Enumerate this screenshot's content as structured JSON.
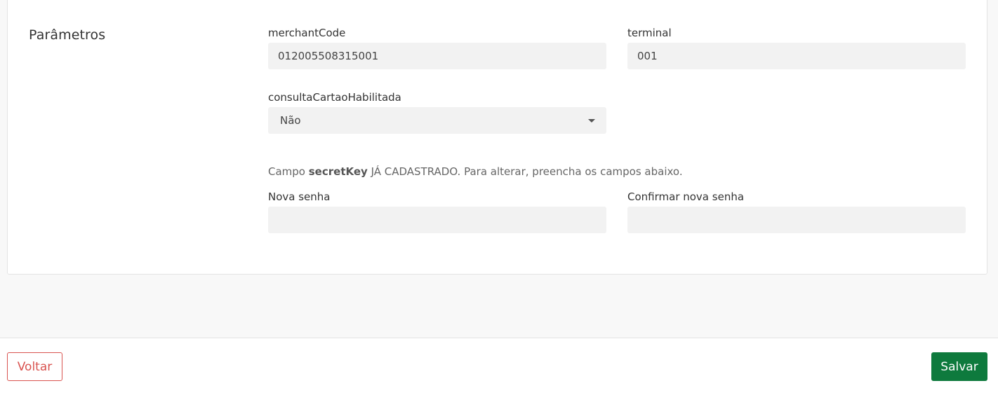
{
  "section": {
    "title": "Parâmetros"
  },
  "fields": {
    "merchant_code": {
      "label": "merchantCode",
      "value": "012005508315001"
    },
    "terminal": {
      "label": "terminal",
      "value": "001"
    },
    "consulta_cartao": {
      "label": "consultaCartaoHabilitada",
      "value": "Não"
    },
    "nova_senha": {
      "label": "Nova senha",
      "value": ""
    },
    "confirmar_senha": {
      "label": "Confirmar nova senha",
      "value": ""
    }
  },
  "hint": {
    "prefix": "Campo ",
    "key": "secretKey",
    "suffix": " JÁ CADASTRADO. Para alterar, preencha os campos abaixo."
  },
  "footer": {
    "back_label": "Voltar",
    "save_label": "Salvar"
  },
  "colors": {
    "save": "#0e7a3d",
    "back": "#d9534f",
    "input_bg": "#f2f2f2"
  }
}
